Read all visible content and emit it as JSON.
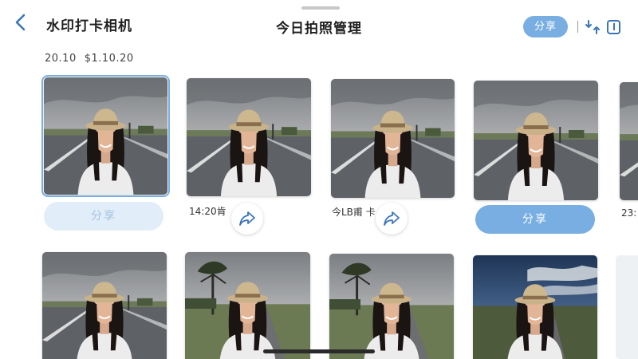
{
  "header": {
    "app_title": "水印打卡相机",
    "page_title": "今日拍照管理",
    "share_label": "分享",
    "icons": [
      "back-chevron-icon",
      "swap-arrows-icon",
      "info-box-icon"
    ]
  },
  "date_line": {
    "left": "20.10",
    "right": "$1.10.20"
  },
  "row1": {
    "share_left_label": "分享",
    "share_right_label": "分享",
    "time1": "14:20肯",
    "time2": "今LB甫 卡",
    "time3": "23:"
  },
  "colors": {
    "accent": "#78aee2",
    "accent_light": "#e1edf8",
    "icon_blue": "#3b76b8"
  }
}
